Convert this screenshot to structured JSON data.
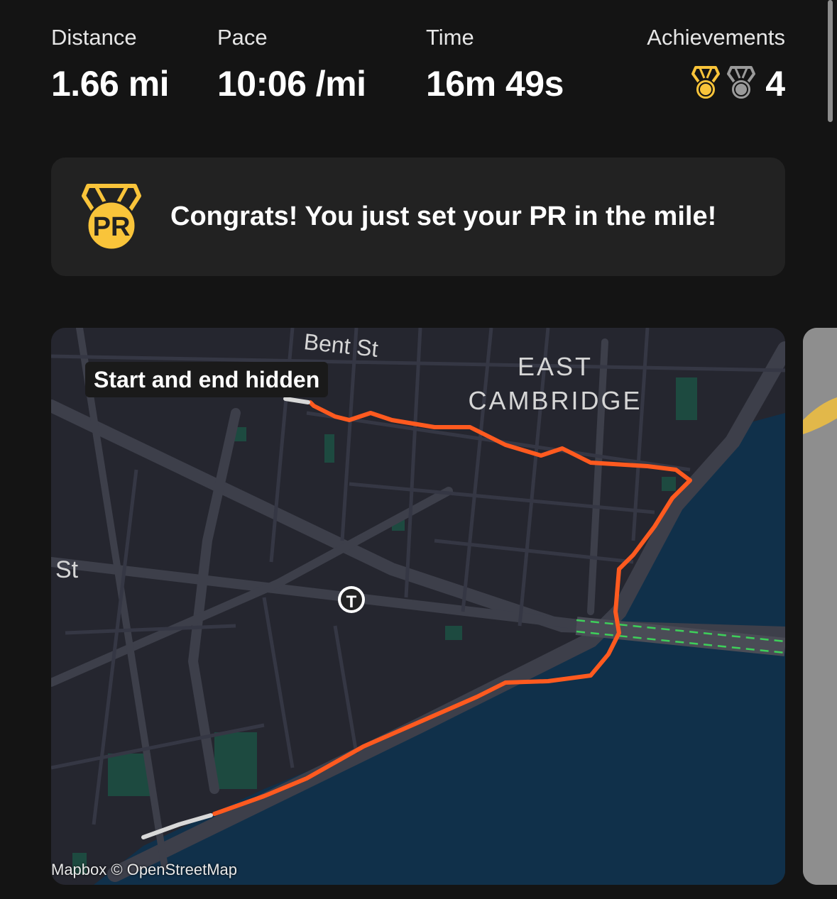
{
  "stats": {
    "distance": {
      "label": "Distance",
      "value": "1.66 mi"
    },
    "pace": {
      "label": "Pace",
      "value": "10:06 /mi"
    },
    "time": {
      "label": "Time",
      "value": "16m 49s"
    },
    "achievements": {
      "label": "Achievements",
      "count": "4",
      "icons": [
        "gold-medal-icon",
        "silver-medal-icon"
      ]
    }
  },
  "banner": {
    "icon": "pr-medal-icon",
    "icon_text": "PR",
    "message": "Congrats! You just set your PR in the mile!"
  },
  "map": {
    "badge": "Start and end hidden",
    "labels": {
      "bent_st": "Bent St",
      "neighborhood_line1": "EAST",
      "neighborhood_line2": "CAMBRIDGE",
      "st": "St"
    },
    "transit_icon": "T",
    "attribution": "Mapbox © OpenStreetMap",
    "route_color": "#ff5a1f",
    "water_color": "#10304a",
    "land_color": "#25262f"
  },
  "colors": {
    "gold": "#f9c43a",
    "silver": "#9a9a9a",
    "background": "#141414",
    "banner_bg": "#222222"
  }
}
